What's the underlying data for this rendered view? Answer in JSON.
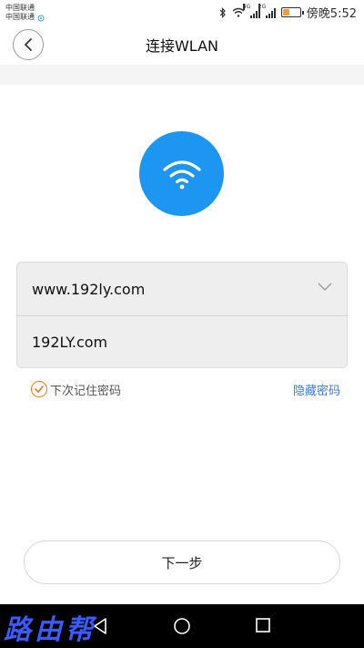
{
  "status_bar": {
    "carrier_1": "中国联通",
    "carrier_2": "中国联通",
    "net_4g": "4G",
    "net_2g": "2G",
    "time": "傍晚5:52",
    "battery_level": 0.4,
    "icons": [
      "bluetooth-icon",
      "wifi-icon",
      "signal-icon",
      "battery-icon"
    ]
  },
  "header": {
    "title": "连接WLAN"
  },
  "form": {
    "ssid": "www.192ly.com",
    "password": "192LY.com"
  },
  "options": {
    "remember_label": "下次记住密码",
    "remember_checked": true,
    "hide_password_label": "隐藏密码"
  },
  "actions": {
    "next_label": "下一步"
  },
  "watermark": {
    "text": "路由帮"
  },
  "colors": {
    "accent_blue": "#1c96f0",
    "check_orange": "#f07a1a",
    "link_blue": "#3a7bd5"
  }
}
